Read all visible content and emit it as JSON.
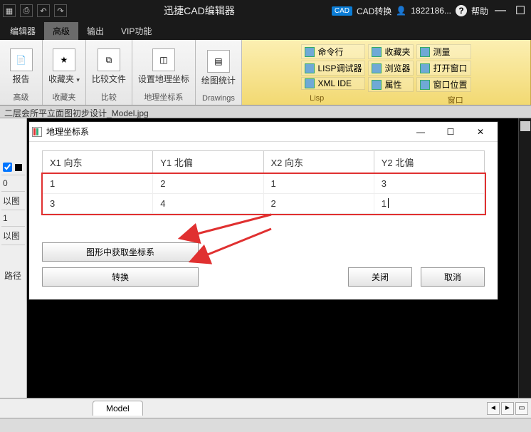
{
  "titlebar": {
    "app_title": "迅捷CAD编辑器",
    "cad_badge": "CAD",
    "cad_convert": "CAD转换",
    "user": "1822186...",
    "help": "帮助"
  },
  "menubar": {
    "tabs": [
      "编辑器",
      "高级",
      "输出",
      "VIP功能"
    ],
    "active_index": 1
  },
  "ribbon": {
    "groups": [
      {
        "label": "报告",
        "category": "高级"
      },
      {
        "label": "收藏夹",
        "category": "收藏夹",
        "has_dropdown": true
      },
      {
        "label": "比较文件",
        "category": "比较"
      },
      {
        "label": "设置地理坐标",
        "category": "地理坐标系"
      },
      {
        "label": "绘图统计",
        "category": "Drawings"
      }
    ],
    "gold": {
      "category_left": "Lisp",
      "category_right": "窗口",
      "col1": [
        "命令行",
        "LISP调试器",
        "XML IDE"
      ],
      "col2": [
        "收藏夹",
        "浏览器",
        "属性"
      ],
      "col3": [
        "测量",
        "打开窗口",
        "窗口位置"
      ]
    }
  },
  "file_tab": "二层会所平立面图初步设计_Model.jpg",
  "left_rail": {
    "row0": "0",
    "row1": "以图",
    "row2": "1",
    "row3": "以图",
    "path_label": "路径"
  },
  "dialog": {
    "title": "地理坐标系",
    "headers": [
      "X1 向东",
      "Y1 北偏",
      "X2 向东",
      "Y2 北偏"
    ],
    "rows": [
      [
        "1",
        "2",
        "1",
        "3"
      ],
      [
        "3",
        "4",
        "2",
        "1"
      ]
    ],
    "btn_get": "图形中获取坐标系",
    "btn_convert": "转换",
    "btn_close": "关闭",
    "btn_cancel": "取消"
  },
  "bottom": {
    "tab": "Model"
  }
}
